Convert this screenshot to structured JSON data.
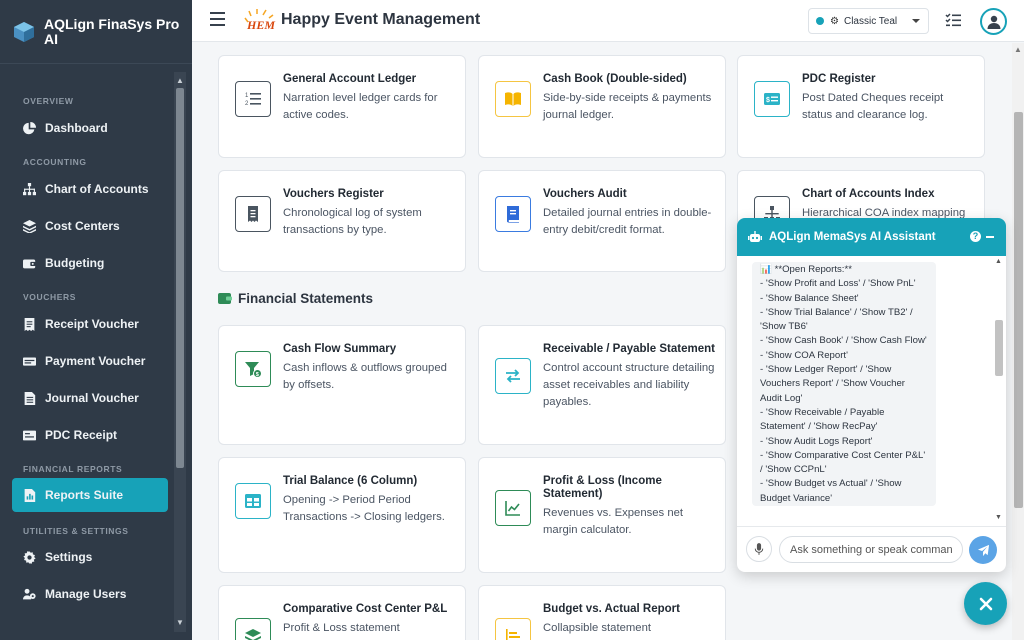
{
  "sidebar": {
    "brand": "AQLign FinaSys Pro AI",
    "sections": {
      "overview": "OVERVIEW",
      "accounting": "ACCOUNTING",
      "vouchers": "VOUCHERS",
      "financial_reports": "FINANCIAL REPORTS",
      "utilities": "UTILITIES & SETTINGS"
    },
    "items": {
      "dashboard": "Dashboard",
      "chart_of_accounts": "Chart of Accounts",
      "cost_centers": "Cost Centers",
      "budgeting": "Budgeting",
      "receipt_voucher": "Receipt Voucher",
      "payment_voucher": "Payment Voucher",
      "journal_voucher": "Journal Voucher",
      "pdc_receipt": "PDC Receipt",
      "reports_suite": "Reports Suite",
      "settings": "Settings",
      "manage_users": "Manage Users"
    },
    "active_item": "Reports Suite"
  },
  "header": {
    "title": "Happy Event Management",
    "theme_label": "Classic Teal",
    "accent_color": "#17a2b8"
  },
  "cards": {
    "general_ledger": {
      "title": "General Account Ledger",
      "desc": "Narration level ledger cards for active codes."
    },
    "cash_book": {
      "title": "Cash Book (Double-sided)",
      "desc": "Side-by-side receipts & payments journal ledger."
    },
    "pdc_register": {
      "title": "PDC Register",
      "desc": "Post Dated Cheques receipt status and clearance log."
    },
    "vouchers_register": {
      "title": "Vouchers Register",
      "desc": "Chronological log of system transactions by type."
    },
    "vouchers_audit": {
      "title": "Vouchers Audit",
      "desc": "Detailed journal entries in double-entry debit/credit format."
    },
    "coa_index": {
      "title": "Chart of Accounts Index",
      "desc": "Hierarchical COA index mapping"
    },
    "cash_flow": {
      "title": "Cash Flow Summary",
      "desc": "Cash inflows & outflows grouped by offsets."
    },
    "receivable_payable": {
      "title": "Receivable / Payable Statement",
      "desc": "Control account structure detailing asset receivables and liability payables."
    },
    "trial_balance": {
      "title": "Trial Balance (6 Column)",
      "desc": "Opening -> Period Period Transactions -> Closing ledgers."
    },
    "profit_loss": {
      "title": "Profit & Loss (Income Statement)",
      "desc": "Revenues vs. Expenses net margin calculator."
    },
    "cost_center_pl": {
      "title": "Comparative Cost Center P&L",
      "desc": "Profit & Loss statement"
    },
    "budget_actual": {
      "title": "Budget vs. Actual Report",
      "desc": "Collapsible statement"
    }
  },
  "sections": {
    "financial_statements": "Financial Statements"
  },
  "chat": {
    "title": "AQLign MemaSys AI Assistant",
    "help": "?",
    "input_placeholder": "Ask something or speak command...",
    "message_lines": [
      "📊 **Open Reports:**",
      "- 'Show Profit and Loss' / 'Show PnL'",
      "- 'Show Balance Sheet'",
      "- 'Show Trial Balance' / 'Show TB2' / 'Show TB6'",
      "- 'Show Cash Book' / 'Show Cash Flow'",
      "- 'Show COA Report'",
      "- 'Show Ledger Report' / 'Show Vouchers Report' / 'Show Voucher Audit Log'",
      "- 'Show Receivable / Payable Statement' / 'Show RecPay'",
      "- 'Show Audit Logs Report'",
      "- 'Show Comparative Cost Center P&L' / 'Show CCPnL'",
      "- 'Show Budget vs Actual' / 'Show Budget Variance'"
    ]
  }
}
